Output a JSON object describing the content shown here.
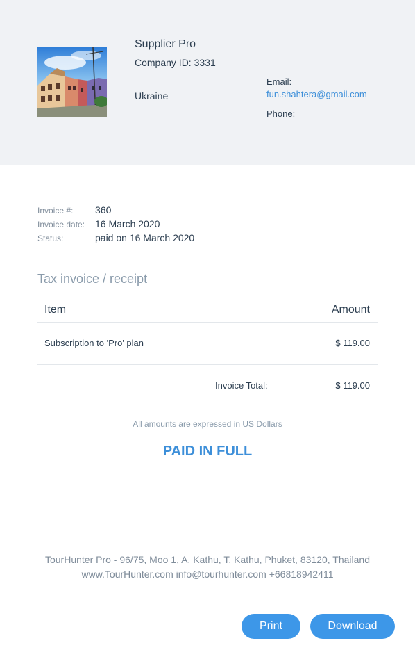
{
  "supplier": {
    "name": "Supplier Pro",
    "company_id": "Company ID: 3331",
    "country": "Ukraine",
    "email_label": "Email:",
    "email": "fun.shahtera@gmail.com",
    "phone_label": "Phone:"
  },
  "invoice": {
    "number_label": "Invoice #:",
    "number": "360",
    "date_label": "Invoice date:",
    "date": "16 March 2020",
    "status_label": "Status:",
    "status": "paid on 16 March 2020"
  },
  "receipt": {
    "title": "Tax invoice / receipt",
    "col_item": "Item",
    "col_amount": "Amount",
    "items": [
      {
        "name": "Subscription to 'Pro' plan",
        "amount": "$ 119.00"
      }
    ],
    "total_label": "Invoice Total:",
    "total": "$ 119.00",
    "currency_note": "All amounts are expressed in US Dollars",
    "paid_stamp": "PAID IN FULL"
  },
  "footer": {
    "address_line": "TourHunter Pro - 96/75, Moo 1, A. Kathu, T. Kathu, Phuket, 83120, Thailand",
    "contact_line": "www.TourHunter.com info@tourhunter.com +66818942411"
  },
  "actions": {
    "print_label": "Print",
    "download_label": "Download"
  },
  "colors": {
    "accent": "#3d8fd9",
    "button": "#3d97e8",
    "header_bg": "#f0f2f5"
  }
}
